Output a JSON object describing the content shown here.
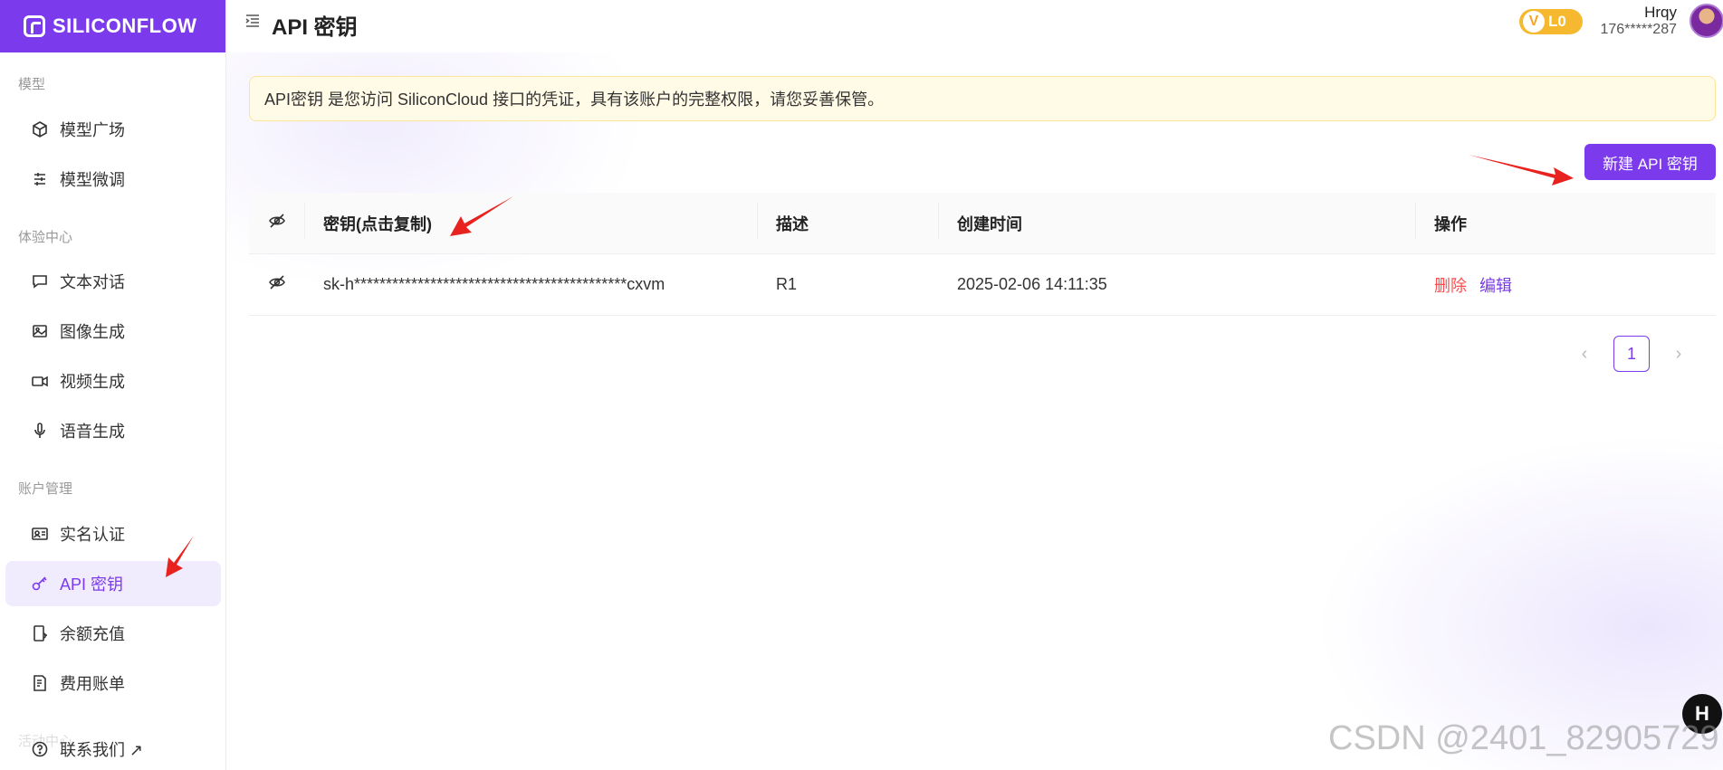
{
  "brand": {
    "logo_text": "SILICONFLOW"
  },
  "sidebar": {
    "groups": [
      {
        "label": "模型"
      },
      {
        "label": "体验中心"
      },
      {
        "label": "账户管理"
      },
      {
        "label": "活动中心"
      }
    ],
    "items": [
      {
        "label": "模型广场",
        "icon": "cube-icon"
      },
      {
        "label": "模型微调",
        "icon": "sliders-icon"
      },
      {
        "label": "文本对话",
        "icon": "chat-icon"
      },
      {
        "label": "图像生成",
        "icon": "image-icon"
      },
      {
        "label": "视频生成",
        "icon": "video-icon"
      },
      {
        "label": "语音生成",
        "icon": "mic-icon"
      },
      {
        "label": "实名认证",
        "icon": "id-card-icon"
      },
      {
        "label": "API 密钥",
        "icon": "key-icon",
        "active": true
      },
      {
        "label": "余额充值",
        "icon": "recharge-icon"
      },
      {
        "label": "费用账单",
        "icon": "bill-icon"
      }
    ],
    "contact": {
      "label": "联系我们 ↗"
    }
  },
  "header": {
    "title": "API 密钥",
    "level": "L0",
    "level_mark": "V",
    "user_name": "Hrqy",
    "user_phone": "176*****287"
  },
  "notice": {
    "text": "API密钥 是您访问 SiliconCloud 接口的凭证，具有该账户的完整权限，请您妥善保管。"
  },
  "actions": {
    "new_key_label": "新建 API 密钥"
  },
  "table": {
    "headers": {
      "key": "密钥(点击复制)",
      "desc": "描述",
      "time": "创建时间",
      "ops": "操作"
    },
    "rows": [
      {
        "key": "sk-h*******************************************cxvm",
        "desc": "R1",
        "time": "2025-02-06 14:11:35",
        "delete_label": "删除",
        "edit_label": "编辑"
      }
    ]
  },
  "pagination": {
    "current": "1"
  },
  "floating": {
    "label": "H"
  },
  "watermark": "CSDN @2401_82905729",
  "colors": {
    "accent": "#7c3aed",
    "danger": "#ff4d4f",
    "notice_bg": "#fffbe6",
    "level_badge": "#f5b82e",
    "arrow": "#e8231f"
  }
}
